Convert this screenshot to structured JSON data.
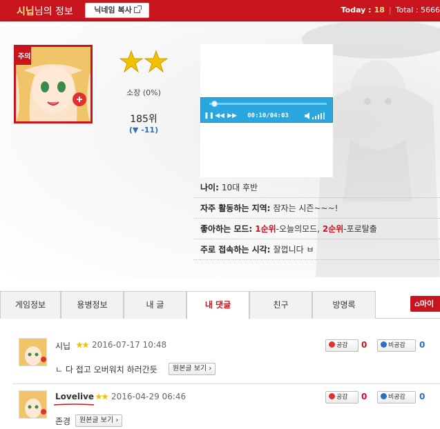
{
  "header": {
    "name": "시닙",
    "title_suffix": "님의 정보",
    "copy_nickname_label": "닉네임 복사",
    "today_label": "Today :",
    "today_value": "18",
    "total_label": "Total : 5666"
  },
  "profile": {
    "avatar_badge": "주의",
    "rank_name": "소장 (0%)",
    "rank": "185위",
    "rank_change": "(▼ -11)",
    "player": {
      "time": "00:10/04:03",
      "progress": 0.04
    },
    "info": [
      {
        "label": "나이:",
        "value": "10대 후반"
      },
      {
        "label": "자주 활동하는 지역:",
        "value": "잠자는 시즌~~~!"
      },
      {
        "label": "좋아하는 모드:",
        "mode1_rank": "1순위",
        "mode1": "-오늘의모드,",
        "mode2_rank": "2순위",
        "mode2": "-포로탈출"
      },
      {
        "label": "주로 접속하는 시각:",
        "value": "잘껍니다 ㅂ"
      }
    ]
  },
  "tabs": [
    {
      "label": "게임정보",
      "active": false
    },
    {
      "label": "용병정보",
      "active": false
    },
    {
      "label": "내 글",
      "active": false
    },
    {
      "label": "내 댓글",
      "active": true
    },
    {
      "label": "친구",
      "active": false
    },
    {
      "label": "방명록",
      "active": false
    }
  ],
  "my_button_label": "마이",
  "comments": [
    {
      "name": "시닙",
      "date": "2016-07-17 10:48",
      "text": "ㄴ 다 접고 오버워치 하러간듯",
      "original_label": "원본글 보기",
      "like_label": "공감",
      "like_count": "0",
      "dislike_label": "비공감",
      "dislike_count": "0"
    },
    {
      "name": "Lovelive",
      "date": "2016-04-29 06:46",
      "text": "존경",
      "original_label": "원본글 보기",
      "like_label": "공감",
      "like_count": "0",
      "dislike_label": "비공감",
      "dislike_count": "0"
    }
  ],
  "colors": {
    "brand_red": "#c8141c",
    "player_blue": "#2ba7e0",
    "star_gold": "#f2c200",
    "link_blue": "#2a6fc0"
  }
}
